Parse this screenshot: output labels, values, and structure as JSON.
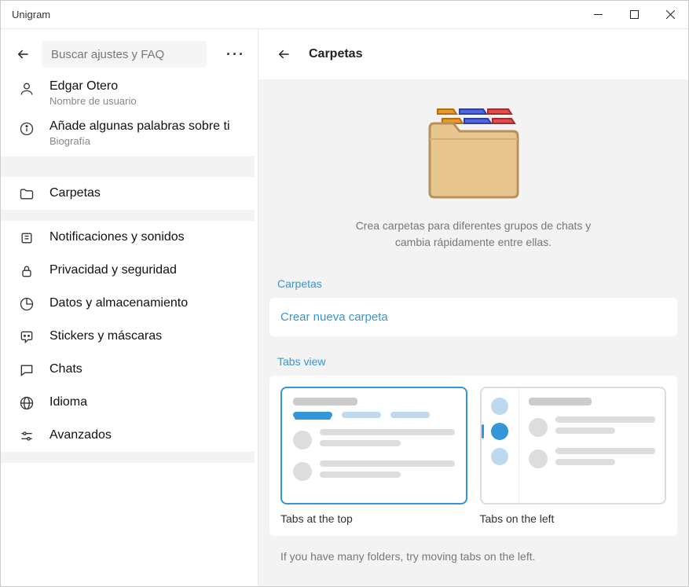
{
  "window": {
    "title": "Unigram"
  },
  "sidebar": {
    "search_placeholder": "Buscar ajustes y FAQ",
    "profile": {
      "name": "Edgar Otero",
      "name_caption": "Nombre de usuario",
      "bio_prompt": "Añade algunas palabras sobre ti",
      "bio_caption": "Biografía"
    },
    "items": {
      "folders": "Carpetas",
      "notifications": "Notificaciones y sonidos",
      "privacy": "Privacidad y seguridad",
      "data": "Datos y almacenamiento",
      "stickers": "Stickers y máscaras",
      "chats": "Chats",
      "language": "Idioma",
      "advanced": "Avanzados"
    }
  },
  "content": {
    "title": "Carpetas",
    "hero_description": "Crea carpetas para diferentes grupos de chats y cambia rápidamente entre ellas.",
    "section_folders": "Carpetas",
    "create_folder": "Crear nueva carpeta",
    "section_tabs": "Tabs view",
    "tab_top": "Tabs at the top",
    "tab_left": "Tabs on the left",
    "hint": "If you have many folders, try moving tabs on the left."
  }
}
